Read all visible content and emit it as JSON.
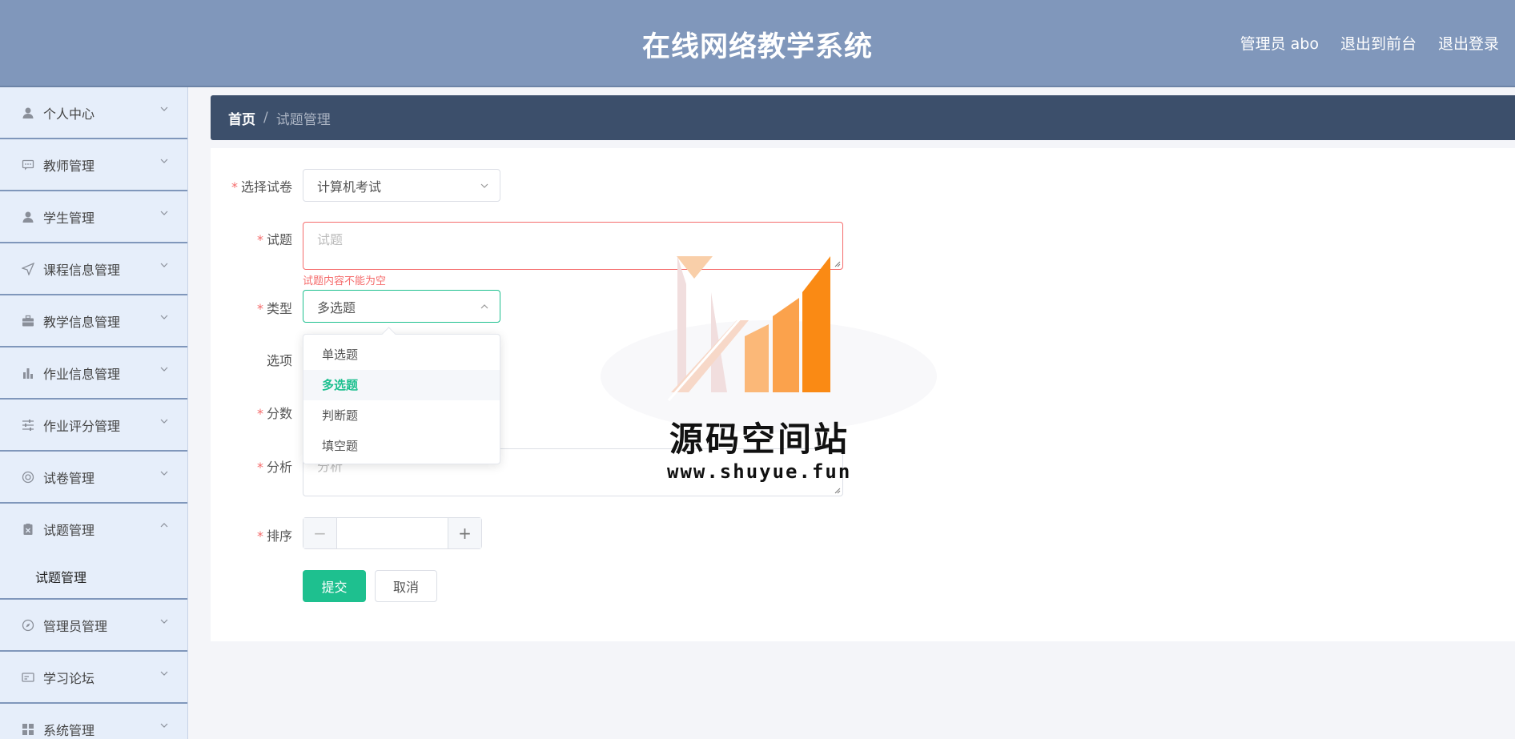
{
  "header": {
    "title": "在线网络教学系统",
    "user": "管理员 abo",
    "to_front": "退出到前台",
    "logout": "退出登录"
  },
  "sidebar": {
    "items": [
      {
        "label": "个人中心",
        "icon": "user-icon"
      },
      {
        "label": "教师管理",
        "icon": "chat-icon"
      },
      {
        "label": "学生管理",
        "icon": "user-icon"
      },
      {
        "label": "课程信息管理",
        "icon": "send-icon"
      },
      {
        "label": "教学信息管理",
        "icon": "briefcase-icon"
      },
      {
        "label": "作业信息管理",
        "icon": "bar-chart-icon"
      },
      {
        "label": "作业评分管理",
        "icon": "sliders-icon"
      },
      {
        "label": "试卷管理",
        "icon": "lifebuoy-icon"
      },
      {
        "label": "试题管理",
        "icon": "clipboard-icon",
        "expanded": true
      },
      {
        "label": "管理员管理",
        "icon": "compass-icon"
      },
      {
        "label": "学习论坛",
        "icon": "card-icon"
      },
      {
        "label": "系统管理",
        "icon": "grid-icon"
      }
    ],
    "submenu": {
      "label": "试题管理"
    }
  },
  "breadcrumb": {
    "home": "首页",
    "separator": "/",
    "current": "试题管理"
  },
  "form": {
    "paper": {
      "label": "选择试卷",
      "value": "计算机考试"
    },
    "question": {
      "label": "试题",
      "placeholder": "试题",
      "error": "试题内容不能为空"
    },
    "type": {
      "label": "类型",
      "value": "多选题"
    },
    "options": {
      "label": "选项"
    },
    "score": {
      "label": "分数"
    },
    "analysis": {
      "label": "分析",
      "placeholder": "分析"
    },
    "order": {
      "label": "排序",
      "minus": "−",
      "plus": "+"
    },
    "submit": "提交",
    "cancel": "取消"
  },
  "dropdown": {
    "options": [
      "单选题",
      "多选题",
      "判断题",
      "填空题"
    ],
    "selected": "多选题"
  },
  "watermark": {
    "text": "源码空间站",
    "url": "www.shuyue.fun"
  },
  "colors": {
    "header": "#8097bb",
    "accent": "#1ec08f",
    "breadcrumb": "#3c4f6b",
    "error": "#f56c6c",
    "sidebar": "#e6eefa"
  }
}
